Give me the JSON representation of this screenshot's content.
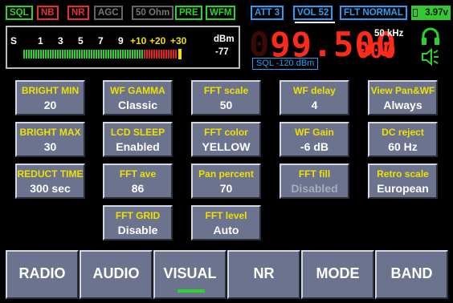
{
  "indicators": [
    {
      "label": "SQL",
      "color": "green"
    },
    {
      "label": "NB",
      "color": "red"
    },
    {
      "label": "NR",
      "color": "red"
    },
    {
      "label": "AGC",
      "color": "gray"
    },
    {
      "label": "50 Ohm",
      "color": "gray"
    },
    {
      "label": "PRE",
      "color": "green"
    },
    {
      "label": "WFM",
      "color": "green"
    },
    {
      "label": "ATT 3",
      "color": "blue"
    },
    {
      "label": "VOL 52",
      "color": "blue"
    },
    {
      "label": "FLT NORMAL",
      "color": "blue"
    }
  ],
  "battery": "3.97v",
  "smeter": {
    "scale": [
      "S",
      "1",
      "3",
      "5",
      "7",
      "9",
      "+10",
      "+20",
      "+30"
    ],
    "unit": "dBm",
    "level_dbm": "-77",
    "level_fraction": 0.95
  },
  "frequency": {
    "main_dim": "0",
    "main": "99.500",
    "sub": "000",
    "step": "50 kHz",
    "squelch": "SQL -120 dBm"
  },
  "icons": {
    "headphone": "headphone-icon",
    "speaker": "speaker-icon"
  },
  "buttons": [
    {
      "label": "BRIGHT MIN",
      "value": "20"
    },
    {
      "label": "WF GAMMA",
      "value": "Classic"
    },
    {
      "label": "FFT scale",
      "value": "50"
    },
    {
      "label": "WF delay",
      "value": "4"
    },
    {
      "label": "View Pan&WF",
      "value": "Always"
    },
    {
      "label": "BRIGHT MAX",
      "value": "30"
    },
    {
      "label": "LCD SLEEP",
      "value": "Enabled"
    },
    {
      "label": "FFT color",
      "value": "YELLOW"
    },
    {
      "label": "WF Gain",
      "value": "-6 dB"
    },
    {
      "label": "DC reject",
      "value": "60 Hz"
    },
    {
      "label": "REDUCT TIME",
      "value": "300 sec"
    },
    {
      "label": "FFT ave",
      "value": "86"
    },
    {
      "label": "Pan percent",
      "value": "70"
    },
    {
      "label": "FFT fill",
      "value": "Disabled"
    },
    {
      "label": "Retro scale",
      "value": "European"
    },
    {
      "label": "FFT GRID",
      "value": "Disable"
    },
    {
      "label": "FFT level",
      "value": "Auto"
    }
  ],
  "tabs": [
    "RADIO",
    "AUDIO",
    "VISUAL",
    "NR",
    "MODE",
    "BAND"
  ],
  "active_tab": "VISUAL",
  "colors": {
    "accent_yellow": "#f0e000",
    "green": "#2bd42b",
    "red": "#e83030",
    "blue": "#2a9df4",
    "button_bg": "#6b738e"
  }
}
